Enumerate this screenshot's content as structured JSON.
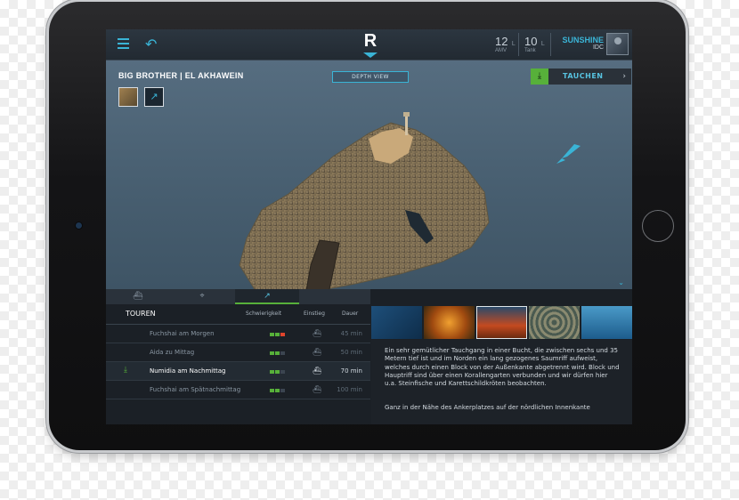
{
  "header": {
    "logo": "R",
    "amv_value": "12",
    "amv_unit": "L",
    "amv_label": "AMV",
    "tank_value": "10",
    "tank_unit": "L",
    "tank_label": "Tank",
    "user_name": "SUNSHINE",
    "user_role": "IDC"
  },
  "view": {
    "site_title": "BIG BROTHER | EL AKHAWEIN",
    "depth_button": "DEPTH VIEW",
    "dive_button": "TAUCHEN",
    "dive_arrow": "›"
  },
  "tours": {
    "title": "TOUREN",
    "col_difficulty": "Schwierigkeit",
    "col_entry": "Einstieg",
    "col_duration": "Dauer",
    "rows": [
      {
        "name": "Fuchshai am Morgen",
        "duration": "45 min",
        "difficulty": 3
      },
      {
        "name": "Aida zu Mittag",
        "duration": "50 min",
        "difficulty": 2
      },
      {
        "name": "Numidia am Nachmittag",
        "duration": "70 min",
        "difficulty": 2
      },
      {
        "name": "Fuchshai am Spätnachmittag",
        "duration": "100 min",
        "difficulty": 2
      }
    ]
  },
  "description": {
    "paragraph1": "Ein sehr gemütlicher Tauchgang in einer Bucht, die zwischen sechs und 35 Metern tief ist und im Norden ein lang gezogenes Saumriff aufweist, welches durch einen Block von der Außenkante abgetrennt wird. Block und Hauptriff sind über einen Korallengarten verbunden und wir dürfen hier u.a. Steinfische und Karettschildkröten beobachten.",
    "paragraph2": "Ganz in der Nähe des Ankerplatzes auf der nördlichen Innenkante"
  },
  "colors": {
    "accent": "#3ab4d6",
    "green": "#57b03a",
    "danger": "#e0452c",
    "screen_bg": "#1b2026"
  }
}
